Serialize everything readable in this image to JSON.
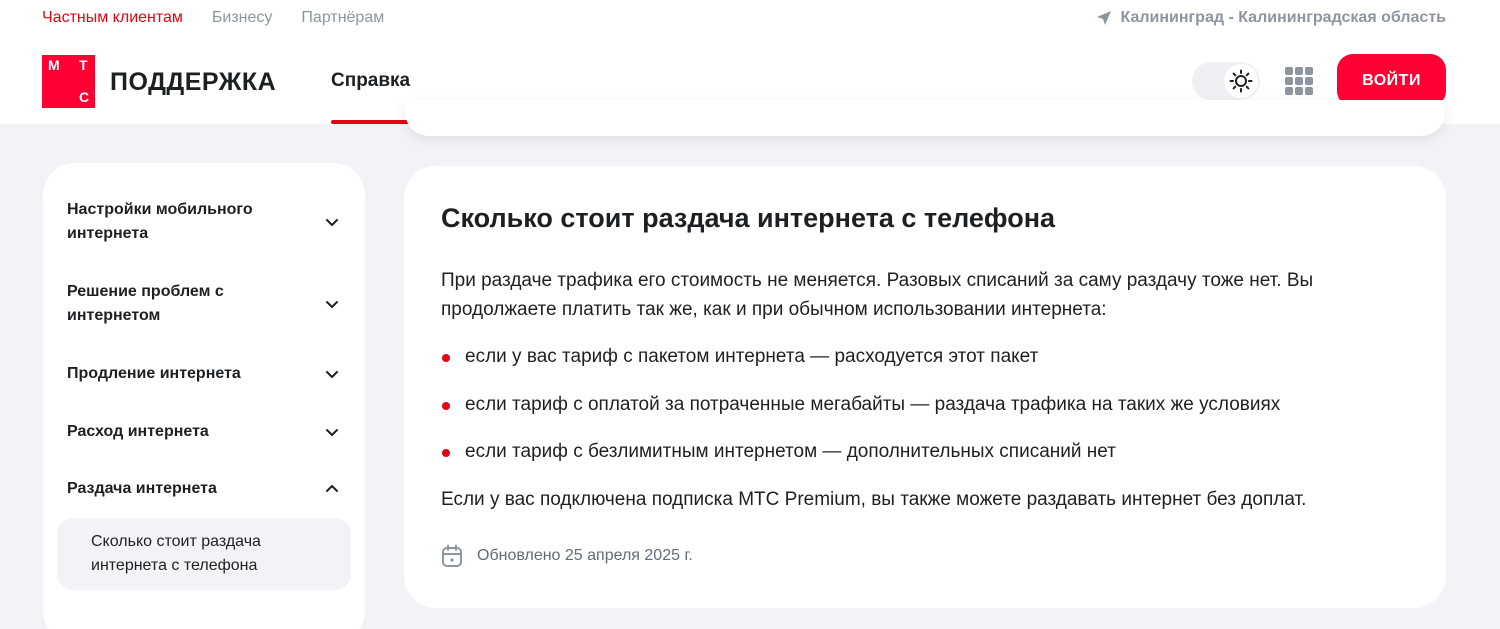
{
  "header": {
    "top_nav": [
      "Частным клиентам",
      "Бизнесу",
      "Партнёрам"
    ],
    "region": "Калининград - Калининградская область",
    "logo_letters": [
      "М",
      "Т",
      "С"
    ],
    "brand": "ПОДДЕРЖКА",
    "nav_tab": "Справка",
    "login_label": "ВОЙТИ"
  },
  "sidebar": {
    "items": [
      {
        "label": "Настройки мобильного интернета",
        "expanded": false
      },
      {
        "label": "Решение проблем с интернетом",
        "expanded": false
      },
      {
        "label": "Продление интернета",
        "expanded": false
      },
      {
        "label": "Расход интернета",
        "expanded": false
      },
      {
        "label": "Раздача интернета",
        "expanded": true
      }
    ],
    "sub_item": "Сколько стоит раздача интернета с телефона"
  },
  "article": {
    "title": "Сколько стоит раздача интернета с телефона",
    "intro": "При раздаче трафика его стоимость не меняется. Разовых списаний за саму раздачу тоже нет. Вы продолжаете платить так же, как и при обычном использовании интернета:",
    "bullets": [
      "если у вас тариф с пакетом интернета — расходуется этот пакет",
      "если тариф с оплатой за потраченные мегабайты — раздача трафика на таких же условиях",
      "если тариф с безлимитным интернетом — дополнительных списаний нет"
    ],
    "outro": "Если у вас подключена подписка МТС Premium, вы также можете раздавать интернет без доплат.",
    "updated": "Обновлено 25 апреля 2025 г."
  },
  "colors": {
    "accent": "#ff0032",
    "accent_text": "#e30611",
    "background": "#f2f3f7",
    "muted": "#8d969f"
  },
  "icons": [
    "location-arrow-icon",
    "sun-icon",
    "apps-grid-icon",
    "chevron-down-icon",
    "chevron-up-icon",
    "calendar-icon"
  ]
}
